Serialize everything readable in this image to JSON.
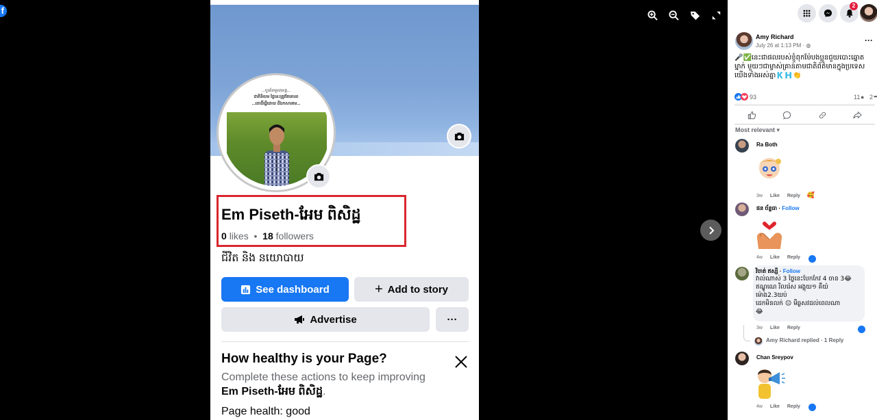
{
  "viewer": {
    "tools": [
      "zoom-in-icon",
      "zoom-out-icon",
      "tag-icon",
      "fullscreen-icon"
    ]
  },
  "page": {
    "name": "Em Piseth-អែម ពិសិដ្ឋ",
    "likes_count": "0",
    "likes_label": "likes",
    "followers_count": "18",
    "followers_label": "followers",
    "bio": "ជីវិត និង នយោបាយ",
    "profile_pic_lines": [
      "...បួនខែមូលខេត្ត...",
      "ជាតិនិយម ថ្ងៃនេះត្រូវតែគោរព",
      "...ពោធិ៍ធ្វើដោយ ដីឯកសារគម..."
    ],
    "buttons": {
      "dashboard": "See dashboard",
      "add_story": "Add to story",
      "advertise": "Advertise",
      "more": "···"
    },
    "health": {
      "title": "How healthy is your Page?",
      "desc_prefix": "Complete these actions to keep improving",
      "desc_name": "Em Piseth-អែម ពិសិដ្ឋ",
      "desc_suffix": ".",
      "status": "Page health: good"
    }
  },
  "topbar": {
    "notification_count": "2"
  },
  "post": {
    "author": "Amy Richard",
    "time": "July 26 at 1:13 PM · ",
    "text": "🎤✅នេះជាផលរបស់ខ្ញុំពុកម៉ែបងប្អូនជួយបោះឆ្នោតម្នាក់ មួយៗជាម្ចាស់គ្រាន់តាមជាតិព័ត៌មានក្នុងប្រទេសយើងទាំងអស់គ្នា🇰🇭👏",
    "reaction_count": "93",
    "comment_count": "11",
    "share_count": "2",
    "sort_label": "Most relevant",
    "accent": "#1877f2"
  },
  "comments": [
    {
      "name": "Ra Both",
      "follow": "",
      "time": "3w",
      "like": "Like",
      "reply": "Reply"
    },
    {
      "name": "ផន ច័ន្ទធា",
      "follow": "Follow",
      "time": "4w",
      "like": "Like",
      "reply": "Reply"
    },
    {
      "name": "វិចាត់ ឥស្សី",
      "follow": "Follow",
      "time": "3w",
      "like": "Like",
      "reply": "Reply",
      "lines": [
        "វាល់ណាស់ 3 ថ្ងៃនេះបែកកែវ 4 ចាន 3😂",
        "ឥណ្ឌូណេ រីលរ៉េស អង្គុយ១ គឹយ៉",
        "ម៉ោង2.3យប់",
        "ដេកមិនលក់ 😑 មីឆ្ងសវដល់ពេលណា",
        "😂"
      ]
    },
    {
      "name": "Chan Sreypov",
      "follow": "",
      "time": "4w",
      "like": "Like",
      "reply": "Reply"
    }
  ],
  "replied": "Amy Richard replied · 1 Reply",
  "separator_dot": "·"
}
